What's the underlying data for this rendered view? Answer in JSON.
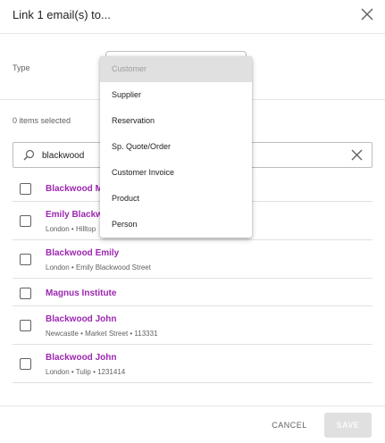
{
  "dialog": {
    "title": "Link 1 email(s) to...",
    "close_icon": "close-icon"
  },
  "type_field": {
    "label": "Type",
    "selected": "Customer",
    "options": [
      "Customer",
      "Supplier",
      "Reservation",
      "Sp. Quote/Order",
      "Customer Invoice",
      "Product",
      "Person"
    ]
  },
  "selection": {
    "count_text": "0 items selected"
  },
  "search": {
    "value": "blackwood",
    "icon": "search-icon",
    "clear_icon": "close-icon"
  },
  "results": [
    {
      "name": "Blackwood Mi",
      "sub": ""
    },
    {
      "name": "Emily Blackwo",
      "sub": "London • Hilltop"
    },
    {
      "name": "Blackwood Emily",
      "sub": "London • Emily Blackwood Street"
    },
    {
      "name": "Magnus Institute",
      "sub": ""
    },
    {
      "name": "Blackwood John",
      "sub": "Newcastle • Market Street • 113331"
    },
    {
      "name": "Blackwood John",
      "sub": "London • Tulip • 1231414"
    }
  ],
  "footer": {
    "cancel_label": "CANCEL",
    "save_label": "SAVE"
  },
  "colors": {
    "accent": "#9c27b0",
    "selected_option_bg": "#e0e0e0",
    "disabled_button_bg": "#e0e0e0"
  }
}
